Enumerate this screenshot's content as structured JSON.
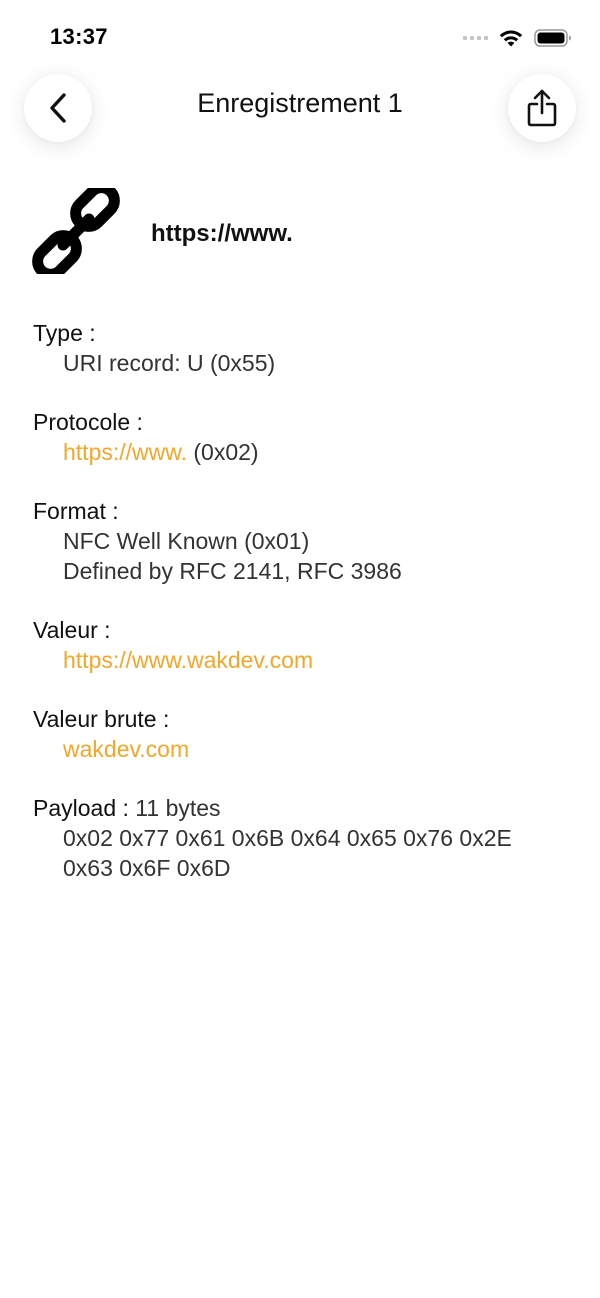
{
  "status_bar": {
    "time": "13:37"
  },
  "nav": {
    "title": "Enregistrement 1"
  },
  "record": {
    "summary": "https://www."
  },
  "fields": {
    "type": {
      "label": "Type :",
      "value": "URI record: U (0x55)"
    },
    "protocol": {
      "label": "Protocole :",
      "value_link": "https://www.",
      "value_suffix": " (0x02)"
    },
    "format": {
      "label": "Format :",
      "line1": "NFC Well Known (0x01)",
      "line2": "Defined by RFC 2141, RFC 3986"
    },
    "value": {
      "label": "Valeur :",
      "link": "https://www.wakdev.com"
    },
    "raw_value": {
      "label": "Valeur brute :",
      "link": "wakdev.com"
    },
    "payload": {
      "label": "Payload :",
      "size": " 11 bytes",
      "line1": "0x02 0x77 0x61 0x6B 0x64 0x65 0x76 0x2E",
      "line2": "0x63 0x6F 0x6D"
    }
  },
  "colors": {
    "accent": "#f0a82c",
    "text": "#111111",
    "secondary_text": "#333333"
  },
  "icons": {
    "back": "chevron-left-icon",
    "share": "share-icon",
    "record_type": "link-icon"
  }
}
